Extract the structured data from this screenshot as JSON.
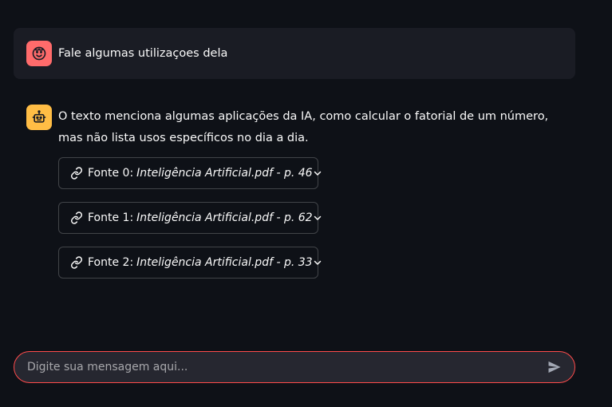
{
  "messages": {
    "user": {
      "avatar_icon": "smiley-face-icon",
      "text": "Fale algumas utilizaçoes dela"
    },
    "assistant": {
      "avatar_icon": "robot-icon",
      "text": "O texto menciona algumas aplicações da IA, como calcular o fatorial de um número, mas não lista usos específicos no dia a dia.",
      "sources": [
        {
          "label": "Fonte 0:",
          "source": "Inteligência Artificial.pdf - p. 46"
        },
        {
          "label": "Fonte 1:",
          "source": "Inteligência Artificial.pdf - p. 62"
        },
        {
          "label": "Fonte 2:",
          "source": "Inteligência Artificial.pdf - p. 33"
        }
      ]
    }
  },
  "chat_input": {
    "placeholder": "Digite sua mensagem aqui...",
    "value": ""
  },
  "colors": {
    "background": "#0e1117",
    "user_avatar": "#ff6b6b",
    "assistant_avatar": "#ffbd45",
    "input_border": "#ff4b4b"
  }
}
